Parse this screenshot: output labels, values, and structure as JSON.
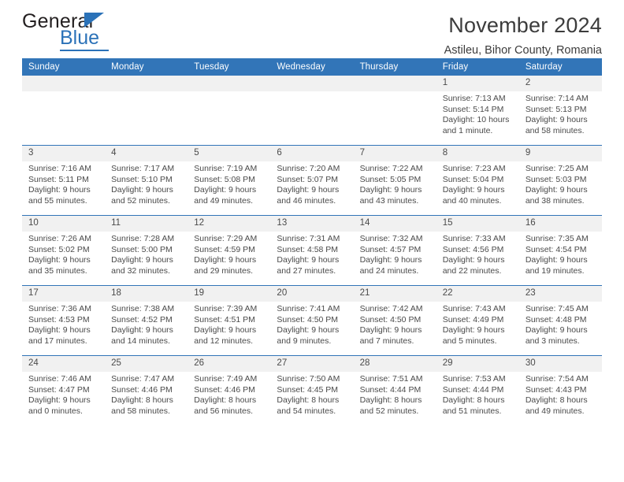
{
  "brand": {
    "name_top": "General",
    "name_bottom": "Blue"
  },
  "header": {
    "title": "November 2024",
    "subtitle": "Astileu, Bihor County, Romania"
  },
  "colors": {
    "header_blue": "#3275b8",
    "brand_blue": "#2b72b8",
    "daynum_band": "#f1f1f1",
    "text": "#4a4a4a"
  },
  "weekday_headers": [
    "Sunday",
    "Monday",
    "Tuesday",
    "Wednesday",
    "Thursday",
    "Friday",
    "Saturday"
  ],
  "weeks": [
    [
      {
        "day": "",
        "blank": true
      },
      {
        "day": "",
        "blank": true
      },
      {
        "day": "",
        "blank": true
      },
      {
        "day": "",
        "blank": true
      },
      {
        "day": "",
        "blank": true
      },
      {
        "day": "1",
        "sunrise": "Sunrise: 7:13 AM",
        "sunset": "Sunset: 5:14 PM",
        "daylight1": "Daylight: 10 hours",
        "daylight2": "and 1 minute."
      },
      {
        "day": "2",
        "sunrise": "Sunrise: 7:14 AM",
        "sunset": "Sunset: 5:13 PM",
        "daylight1": "Daylight: 9 hours",
        "daylight2": "and 58 minutes."
      }
    ],
    [
      {
        "day": "3",
        "sunrise": "Sunrise: 7:16 AM",
        "sunset": "Sunset: 5:11 PM",
        "daylight1": "Daylight: 9 hours",
        "daylight2": "and 55 minutes."
      },
      {
        "day": "4",
        "sunrise": "Sunrise: 7:17 AM",
        "sunset": "Sunset: 5:10 PM",
        "daylight1": "Daylight: 9 hours",
        "daylight2": "and 52 minutes."
      },
      {
        "day": "5",
        "sunrise": "Sunrise: 7:19 AM",
        "sunset": "Sunset: 5:08 PM",
        "daylight1": "Daylight: 9 hours",
        "daylight2": "and 49 minutes."
      },
      {
        "day": "6",
        "sunrise": "Sunrise: 7:20 AM",
        "sunset": "Sunset: 5:07 PM",
        "daylight1": "Daylight: 9 hours",
        "daylight2": "and 46 minutes."
      },
      {
        "day": "7",
        "sunrise": "Sunrise: 7:22 AM",
        "sunset": "Sunset: 5:05 PM",
        "daylight1": "Daylight: 9 hours",
        "daylight2": "and 43 minutes."
      },
      {
        "day": "8",
        "sunrise": "Sunrise: 7:23 AM",
        "sunset": "Sunset: 5:04 PM",
        "daylight1": "Daylight: 9 hours",
        "daylight2": "and 40 minutes."
      },
      {
        "day": "9",
        "sunrise": "Sunrise: 7:25 AM",
        "sunset": "Sunset: 5:03 PM",
        "daylight1": "Daylight: 9 hours",
        "daylight2": "and 38 minutes."
      }
    ],
    [
      {
        "day": "10",
        "sunrise": "Sunrise: 7:26 AM",
        "sunset": "Sunset: 5:02 PM",
        "daylight1": "Daylight: 9 hours",
        "daylight2": "and 35 minutes."
      },
      {
        "day": "11",
        "sunrise": "Sunrise: 7:28 AM",
        "sunset": "Sunset: 5:00 PM",
        "daylight1": "Daylight: 9 hours",
        "daylight2": "and 32 minutes."
      },
      {
        "day": "12",
        "sunrise": "Sunrise: 7:29 AM",
        "sunset": "Sunset: 4:59 PM",
        "daylight1": "Daylight: 9 hours",
        "daylight2": "and 29 minutes."
      },
      {
        "day": "13",
        "sunrise": "Sunrise: 7:31 AM",
        "sunset": "Sunset: 4:58 PM",
        "daylight1": "Daylight: 9 hours",
        "daylight2": "and 27 minutes."
      },
      {
        "day": "14",
        "sunrise": "Sunrise: 7:32 AM",
        "sunset": "Sunset: 4:57 PM",
        "daylight1": "Daylight: 9 hours",
        "daylight2": "and 24 minutes."
      },
      {
        "day": "15",
        "sunrise": "Sunrise: 7:33 AM",
        "sunset": "Sunset: 4:56 PM",
        "daylight1": "Daylight: 9 hours",
        "daylight2": "and 22 minutes."
      },
      {
        "day": "16",
        "sunrise": "Sunrise: 7:35 AM",
        "sunset": "Sunset: 4:54 PM",
        "daylight1": "Daylight: 9 hours",
        "daylight2": "and 19 minutes."
      }
    ],
    [
      {
        "day": "17",
        "sunrise": "Sunrise: 7:36 AM",
        "sunset": "Sunset: 4:53 PM",
        "daylight1": "Daylight: 9 hours",
        "daylight2": "and 17 minutes."
      },
      {
        "day": "18",
        "sunrise": "Sunrise: 7:38 AM",
        "sunset": "Sunset: 4:52 PM",
        "daylight1": "Daylight: 9 hours",
        "daylight2": "and 14 minutes."
      },
      {
        "day": "19",
        "sunrise": "Sunrise: 7:39 AM",
        "sunset": "Sunset: 4:51 PM",
        "daylight1": "Daylight: 9 hours",
        "daylight2": "and 12 minutes."
      },
      {
        "day": "20",
        "sunrise": "Sunrise: 7:41 AM",
        "sunset": "Sunset: 4:50 PM",
        "daylight1": "Daylight: 9 hours",
        "daylight2": "and 9 minutes."
      },
      {
        "day": "21",
        "sunrise": "Sunrise: 7:42 AM",
        "sunset": "Sunset: 4:50 PM",
        "daylight1": "Daylight: 9 hours",
        "daylight2": "and 7 minutes."
      },
      {
        "day": "22",
        "sunrise": "Sunrise: 7:43 AM",
        "sunset": "Sunset: 4:49 PM",
        "daylight1": "Daylight: 9 hours",
        "daylight2": "and 5 minutes."
      },
      {
        "day": "23",
        "sunrise": "Sunrise: 7:45 AM",
        "sunset": "Sunset: 4:48 PM",
        "daylight1": "Daylight: 9 hours",
        "daylight2": "and 3 minutes."
      }
    ],
    [
      {
        "day": "24",
        "sunrise": "Sunrise: 7:46 AM",
        "sunset": "Sunset: 4:47 PM",
        "daylight1": "Daylight: 9 hours",
        "daylight2": "and 0 minutes."
      },
      {
        "day": "25",
        "sunrise": "Sunrise: 7:47 AM",
        "sunset": "Sunset: 4:46 PM",
        "daylight1": "Daylight: 8 hours",
        "daylight2": "and 58 minutes."
      },
      {
        "day": "26",
        "sunrise": "Sunrise: 7:49 AM",
        "sunset": "Sunset: 4:46 PM",
        "daylight1": "Daylight: 8 hours",
        "daylight2": "and 56 minutes."
      },
      {
        "day": "27",
        "sunrise": "Sunrise: 7:50 AM",
        "sunset": "Sunset: 4:45 PM",
        "daylight1": "Daylight: 8 hours",
        "daylight2": "and 54 minutes."
      },
      {
        "day": "28",
        "sunrise": "Sunrise: 7:51 AM",
        "sunset": "Sunset: 4:44 PM",
        "daylight1": "Daylight: 8 hours",
        "daylight2": "and 52 minutes."
      },
      {
        "day": "29",
        "sunrise": "Sunrise: 7:53 AM",
        "sunset": "Sunset: 4:44 PM",
        "daylight1": "Daylight: 8 hours",
        "daylight2": "and 51 minutes."
      },
      {
        "day": "30",
        "sunrise": "Sunrise: 7:54 AM",
        "sunset": "Sunset: 4:43 PM",
        "daylight1": "Daylight: 8 hours",
        "daylight2": "and 49 minutes."
      }
    ]
  ]
}
